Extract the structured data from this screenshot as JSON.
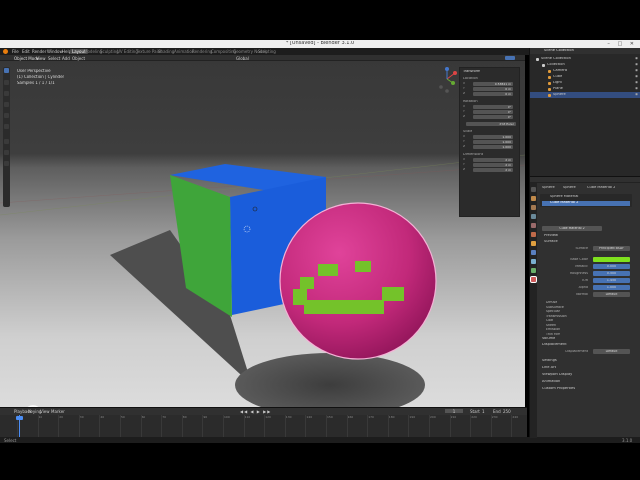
{
  "window": {
    "title": "* [Unsaved] - Blender 3.1.0",
    "controls": "– □ ✕"
  },
  "menubar": {
    "items": [
      "File",
      "Edit",
      "Render",
      "Window",
      "Help"
    ],
    "workspaces": [
      "Layout",
      "Modeling",
      "Sculpting",
      "UV Editing",
      "Texture Paint",
      "Shading",
      "Animation",
      "Rendering",
      "Compositing",
      "Geometry Nodes",
      "Scripting"
    ],
    "active_workspace": "Layout",
    "scene_label": "Scene",
    "view_layer_label": "ViewLayer"
  },
  "viewport": {
    "header_items": [
      "Object Mode",
      "View",
      "Select",
      "Add",
      "Object"
    ],
    "transform_orientation": "Global",
    "info": [
      "User Perspective",
      "(1) Collection | Cylinder",
      "Samples 1 / 1 / 1/1"
    ],
    "gizmo_axes": [
      "X",
      "Y",
      "Z"
    ]
  },
  "npanel": {
    "section": "Transform",
    "location_label": "Location",
    "location": [
      [
        "X",
        "0.53841 m"
      ],
      [
        "Y",
        "0 m"
      ],
      [
        "Z",
        "0 m"
      ]
    ],
    "rotation_label": "Rotation",
    "rotation": [
      [
        "X",
        "0°"
      ],
      [
        "Y",
        "0°"
      ],
      [
        "Z",
        "0°"
      ]
    ],
    "mode_value": "XYZ Euler",
    "scale_label": "Scale",
    "scale": [
      [
        "X",
        "1.000"
      ],
      [
        "Y",
        "1.000"
      ],
      [
        "Z",
        "1.000"
      ]
    ],
    "dimensions_label": "Dimensions",
    "dimensions": [
      [
        "X",
        "2 m"
      ],
      [
        "Y",
        "2 m"
      ],
      [
        "Z",
        "2 m"
      ]
    ],
    "tabs": [
      "Item",
      "Tool",
      "View"
    ]
  },
  "timeline": {
    "menu": [
      "Playback",
      "Keying",
      "View",
      "Marker"
    ],
    "frame_numbers": [
      "0",
      "10",
      "20",
      "30",
      "40",
      "50",
      "60",
      "70",
      "80",
      "90",
      "100",
      "110",
      "120",
      "130",
      "140",
      "150",
      "160",
      "170",
      "180",
      "190",
      "200",
      "210",
      "220",
      "230",
      "240",
      "250"
    ],
    "current_frame": "1",
    "start_label": "Start",
    "start": "1",
    "end_label": "End",
    "end": "250"
  },
  "statusbar": {
    "left": "Select",
    "right": "3.1.0"
  },
  "outliner": {
    "header_label": "Scene Collection",
    "items": [
      {
        "label": "Scene Collection",
        "indent": 0,
        "selected": false
      },
      {
        "label": "Collection",
        "indent": 1,
        "selected": false
      },
      {
        "label": "Camera",
        "indent": 2,
        "selected": false
      },
      {
        "label": "Cube",
        "indent": 2,
        "selected": false
      },
      {
        "label": "Light",
        "indent": 2,
        "selected": false
      },
      {
        "label": "Plane",
        "indent": 2,
        "selected": false
      },
      {
        "label": "Sphere",
        "indent": 2,
        "selected": true
      }
    ]
  },
  "properties": {
    "breadcrumb": [
      "Sphere",
      "Sphere",
      "Cube Material 2"
    ],
    "slots": [
      "Sphere Material",
      "Cube Material 2"
    ],
    "material_name": "Cube Material 2",
    "sections": {
      "preview": "Preview",
      "surface": "Surface",
      "surface_field_label": "Surface",
      "surface_value": "Principled BSDF",
      "rows": [
        {
          "label": "Base Color",
          "value": "",
          "color": "#7fe11e"
        },
        {
          "label": "Metallic",
          "value": "0.000"
        },
        {
          "label": "Roughness",
          "value": "0.500"
        },
        {
          "label": "IOR",
          "value": "1.450"
        },
        {
          "label": "Alpha",
          "value": "1.000"
        },
        {
          "label": "Normal",
          "value": "Default"
        }
      ],
      "subpanels": [
        "Diffuse",
        "Subsurface",
        "Specular",
        "Transmission",
        "Coat",
        "Sheen",
        "Emission",
        "Thin Film"
      ],
      "volume": "Volume",
      "displacement": "Displacement",
      "displacement_label": "Displacement",
      "displacement_value": "Default",
      "settings": "Settings",
      "lineart": "Line Art",
      "viewport_display": "Viewport Display",
      "animation": "Animation",
      "custom_props": "Custom Properties"
    }
  },
  "colors": {
    "accent": "#4772b3",
    "cube_top": "#1f63e0",
    "cube_front": "#1a5ddb",
    "cube_side": "#3fa53a",
    "sphere": "#c2297a",
    "smile": "#74c22a"
  }
}
